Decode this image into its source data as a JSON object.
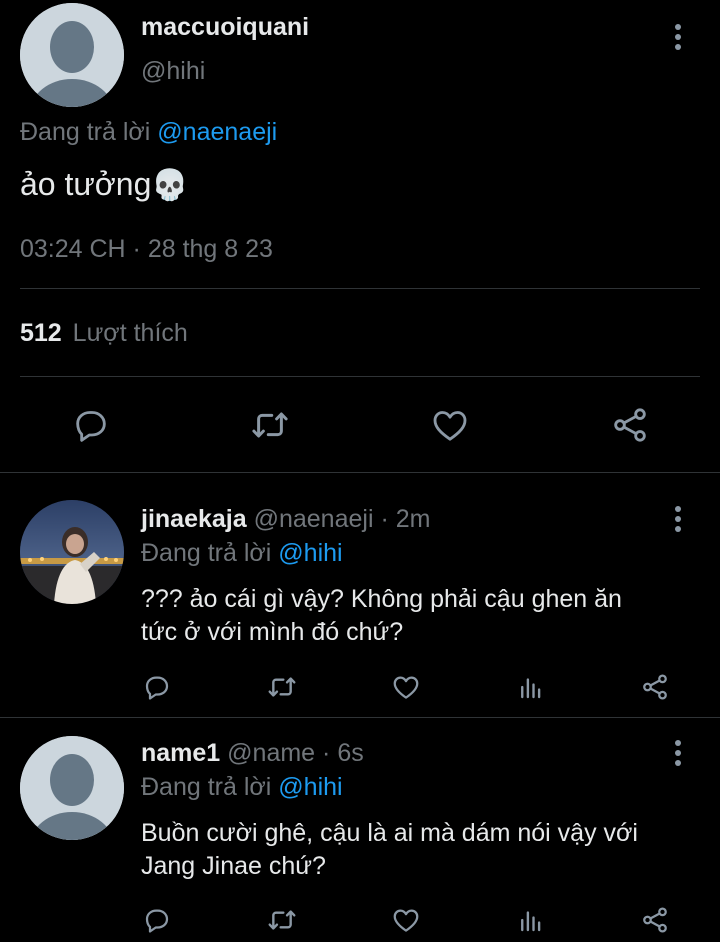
{
  "main_tweet": {
    "display_name": "maccuoiquani",
    "handle": "@hihi",
    "reply_prefix": "Đang trả lời",
    "reply_to": "@naenaeji",
    "text": "ảo tưởng",
    "emoji": "💀",
    "timestamp": "03:24 CH · 28 thg 8 23",
    "likes_count": "512",
    "likes_label": "Lượt thích",
    "actions": [
      "reply-icon",
      "retweet-icon",
      "like-icon",
      "share-icon"
    ]
  },
  "replies": [
    {
      "display_name": "jinaekaja",
      "handle": "@naenaeji",
      "time": "· 2m",
      "reply_prefix": "Đang trả lời",
      "reply_to": "@hihi",
      "line1": "??? ảo cái gì vậy? Không phải cậu ghen ăn",
      "line2": "tức ở với mình đó chứ?",
      "avatar": "photo-avatar",
      "actions": [
        "reply-icon",
        "retweet-icon",
        "like-icon",
        "views-icon",
        "share-icon"
      ]
    },
    {
      "display_name": "name1",
      "handle": "@name",
      "time": "· 6s",
      "reply_prefix": "Đang trả lời",
      "reply_to": "@hihi",
      "line1": "Buồn cười ghê, cậu là ai mà dám nói vậy với",
      "line2": "Jang Jinae chứ?",
      "avatar": "default-avatar",
      "actions": [
        "reply-icon",
        "retweet-icon",
        "like-icon",
        "views-icon",
        "share-icon"
      ]
    }
  ],
  "colors": {
    "background": "#000000",
    "text": "#e7e9ea",
    "muted": "#71767b",
    "link": "#1d9bf0",
    "divider": "#2f3336"
  }
}
